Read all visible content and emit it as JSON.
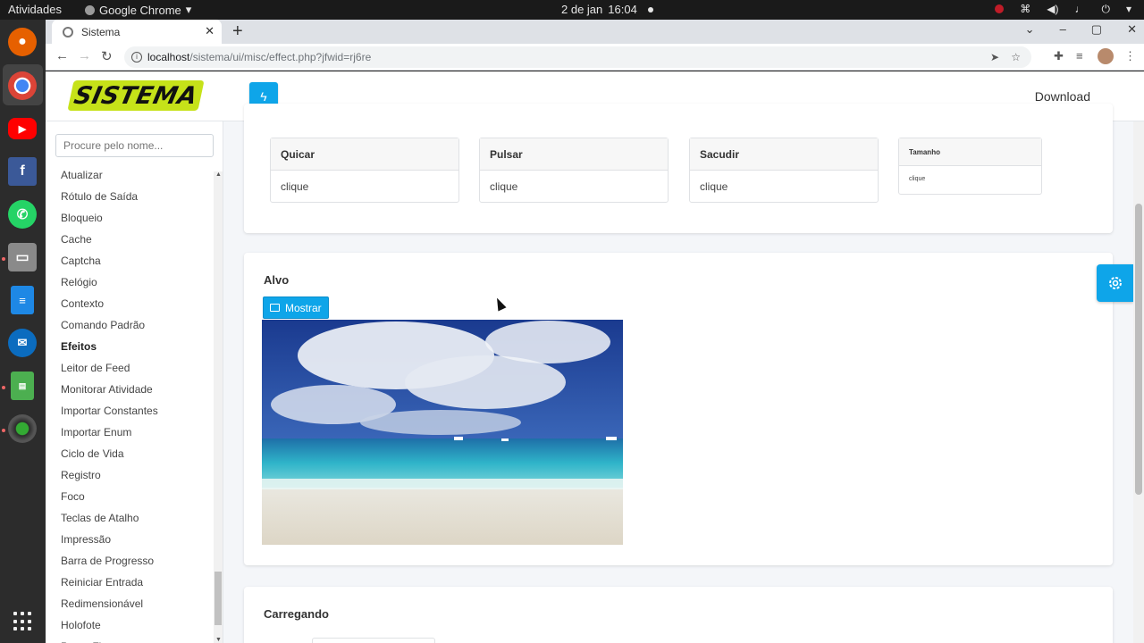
{
  "system_bar": {
    "activities": "Atividades",
    "app_name": "Google Chrome",
    "date": "2 de jan",
    "time": "16:04"
  },
  "browser": {
    "tab_title": "Sistema",
    "url_host": "localhost",
    "url_path": "/sistema/ui/misc/effect.php?jfwid=rj6re"
  },
  "navbar": {
    "logo": "SISTEMA",
    "download": "Download"
  },
  "sidebar": {
    "search_placeholder": "Procure pelo nome...",
    "items": [
      "Atualizar",
      "Rótulo de Saída",
      "Bloqueio",
      "Cache",
      "Captcha",
      "Relógio",
      "Contexto",
      "Comando Padrão",
      "Efeitos",
      "Leitor de Feed",
      "Monitorar Atividade",
      "Importar Constantes",
      "Importar Enum",
      "Ciclo de Vida",
      "Registro",
      "Foco",
      "Teclas de Atalho",
      "Impressão",
      "Barra de Progresso",
      "Reiniciar Entrada",
      "Redimensionável",
      "Holofote",
      "Pegar Fixo"
    ],
    "active_item": "Efeitos"
  },
  "effects": [
    {
      "title": "Quicar",
      "action": "clique"
    },
    {
      "title": "Pulsar",
      "action": "clique"
    },
    {
      "title": "Sacudir",
      "action": "clique"
    },
    {
      "title": "Tamanho",
      "action": "clique"
    }
  ],
  "target": {
    "title": "Alvo",
    "button": "Mostrar",
    "image_name": "beach-photo"
  },
  "loading": {
    "title": "Carregando"
  },
  "colors": {
    "accent": "#0ea5e9",
    "logo_bg": "#c6e219"
  }
}
